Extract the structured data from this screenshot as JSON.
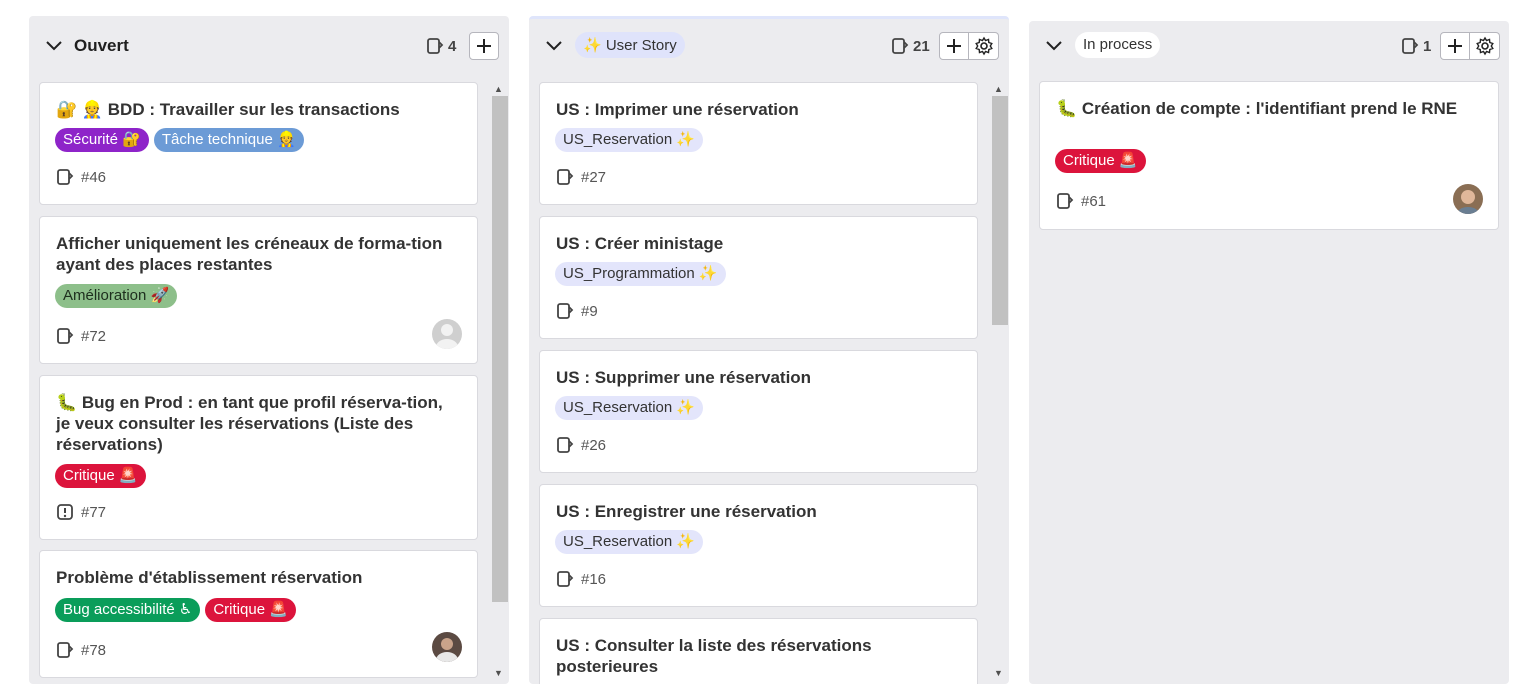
{
  "columns": [
    {
      "title": "Ouvert",
      "count": "4",
      "cards": [
        {
          "title": "🔐 👷 BDD : Travailler sur les transactions",
          "tags": [
            "Sécurité 🔐",
            "Tâche technique 👷"
          ],
          "ref": "#46",
          "ref_icon": "issue-icon"
        },
        {
          "title": "Afficher uniquement les créneaux de forma-tion ayant des places restantes",
          "tags": [
            "Amélioration 🚀"
          ],
          "ref": "#72",
          "ref_icon": "issue-icon",
          "avatar": "default"
        },
        {
          "title": "🐛 Bug en Prod : en tant que profil réserva-tion, je veux consulter les réservations (Liste des réservations)",
          "tags": [
            "Critique 🚨"
          ],
          "ref": "#77",
          "ref_icon": "alert-issue-icon"
        },
        {
          "title": "Problème d'établissement réservation",
          "tags": [
            "Bug accessibilité ♿",
            "Critique 🚨"
          ],
          "ref": "#78",
          "ref_icon": "issue-icon",
          "avatar": "photo"
        }
      ]
    },
    {
      "title": "✨ User Story",
      "count": "21",
      "cards": [
        {
          "title": "US : Imprimer une réservation",
          "tags": [
            "US_Reservation ✨"
          ],
          "ref": "#27"
        },
        {
          "title": "US : Créer ministage",
          "tags": [
            "US_Programmation ✨"
          ],
          "ref": "#9"
        },
        {
          "title": "US : Supprimer une réservation",
          "tags": [
            "US_Reservation ✨"
          ],
          "ref": "#26"
        },
        {
          "title": "US : Enregistrer une réservation",
          "tags": [
            "US_Reservation ✨"
          ],
          "ref": "#16"
        },
        {
          "title": "US : Consulter la liste des réservations posterieures",
          "tags": [],
          "ref": ""
        }
      ]
    },
    {
      "title": "In process",
      "count": "1",
      "cards": [
        {
          "title": "🐛 Création de compte : l'identifiant prend le RNE",
          "tags": [
            "Critique 🚨"
          ],
          "ref": "#61",
          "avatar": "photo"
        }
      ]
    }
  ],
  "tag_colors": {
    "Sécurité": "#8e24c9",
    "Tâche technique": "#6c9bd6",
    "Amélioration": "#8dbf8a",
    "Critique": "#dc143c",
    "Bug accessibilité": "#0a9d5a",
    "US": "#e3e5fb"
  },
  "icons": {
    "collapse": "chevron-down-icon",
    "add": "plus-icon",
    "settings": "gear-icon",
    "count": "issue-icon"
  }
}
